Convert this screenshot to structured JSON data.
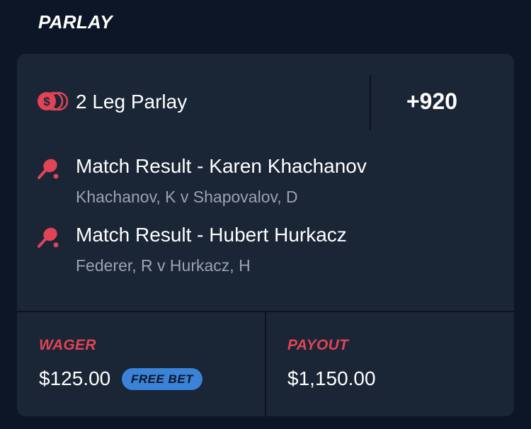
{
  "header": {
    "title": "PARLAY"
  },
  "parlay": {
    "name": "2 Leg Parlay",
    "odds": "+920",
    "icon": "coin-stack-icon"
  },
  "legs": [
    {
      "title": "Match Result - Karen Khachanov",
      "matchup": "Khachanov, K v Shapovalov, D",
      "icon": "tennis-racket-icon"
    },
    {
      "title": "Match Result - Hubert Hurkacz",
      "matchup": "Federer, R v Hurkacz, H",
      "icon": "tennis-racket-icon"
    }
  ],
  "wager": {
    "label": "WAGER",
    "amount": "$125.00",
    "badge": "FREE BET"
  },
  "payout": {
    "label": "PAYOUT",
    "amount": "$1,150.00"
  },
  "colors": {
    "background": "#0d1626",
    "card": "#1a2535",
    "accent_red": "#e04455",
    "badge_blue": "#3b82d9",
    "muted_text": "#9aa3b0"
  }
}
